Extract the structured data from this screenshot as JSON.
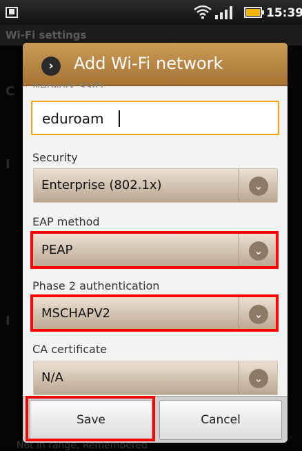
{
  "statusbar": {
    "time": "15:39"
  },
  "background": {
    "title": "Wi-Fi settings",
    "footer_text": "Not in range, Remembered"
  },
  "dialog": {
    "title": "Add Wi-Fi network",
    "ssid": {
      "label": "Network SSID",
      "value": "eduroam"
    },
    "security": {
      "label": "Security",
      "value": "Enterprise (802.1x)"
    },
    "eap": {
      "label": "EAP method",
      "value": "PEAP"
    },
    "phase2": {
      "label": "Phase 2 authentication",
      "value": "MSCHAPV2"
    },
    "ca": {
      "label": "CA certificate",
      "value": "N/A"
    },
    "save_label": "Save",
    "cancel_label": "Cancel"
  },
  "colors": {
    "header": "#b3813f",
    "highlight": "#ff0000",
    "field_focus": "#f0a30a",
    "battery": "#f6b400"
  },
  "icons": [
    "chevron-right-icon",
    "chevron-down-icon",
    "wifi-icon",
    "signal-icon",
    "battery-icon",
    "sim-icon"
  ]
}
